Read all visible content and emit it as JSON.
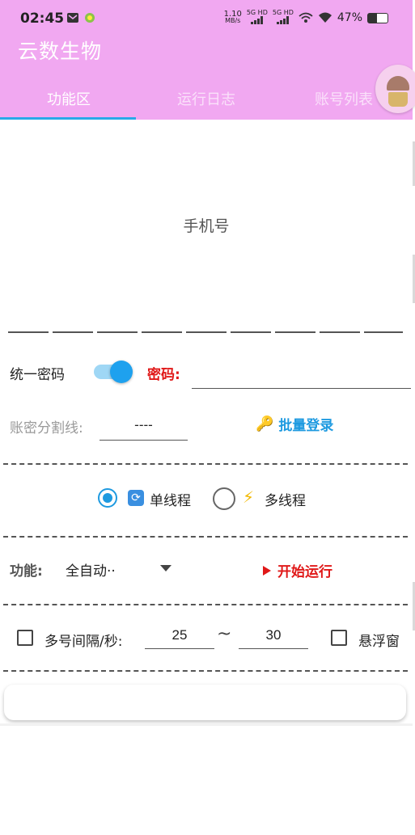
{
  "status_bar": {
    "time": "02:45",
    "net_speed": "1.10",
    "net_unit": "MB/s",
    "sim1": "5G HD",
    "sim2": "5G HD",
    "battery": "47%",
    "battery_level": 0.47
  },
  "app": {
    "title": "云数生物"
  },
  "tabs": [
    {
      "label": "功能区"
    },
    {
      "label": "运行日志"
    },
    {
      "label": "账号列表"
    }
  ],
  "form": {
    "phone_placeholder": "手机号",
    "unify_password_label": "统一密码",
    "unify_password_on": true,
    "password_label": "密码:",
    "password_value": "",
    "separator_label": "账密分割线:",
    "separator_value": "----",
    "batch_login_label": "批量登录",
    "batch_login_icon": "key-icon"
  },
  "threads": {
    "single_label": "单线程",
    "single_icon": "refresh-icon",
    "multi_label": "多线程",
    "multi_icon": "lightning-icon",
    "selected": "single"
  },
  "function": {
    "label": "功能:",
    "value": "全自动··",
    "start_label": "开始运行"
  },
  "interval": {
    "label": "多号间隔/秒:",
    "min": "25",
    "tilde": "~",
    "max": "30",
    "float_window_label": "悬浮窗",
    "interval_checked": false,
    "float_window_checked": false
  },
  "colors": {
    "header": "#f1a8f1",
    "accent_blue": "#1e9ae0",
    "accent_red": "#e01818"
  }
}
